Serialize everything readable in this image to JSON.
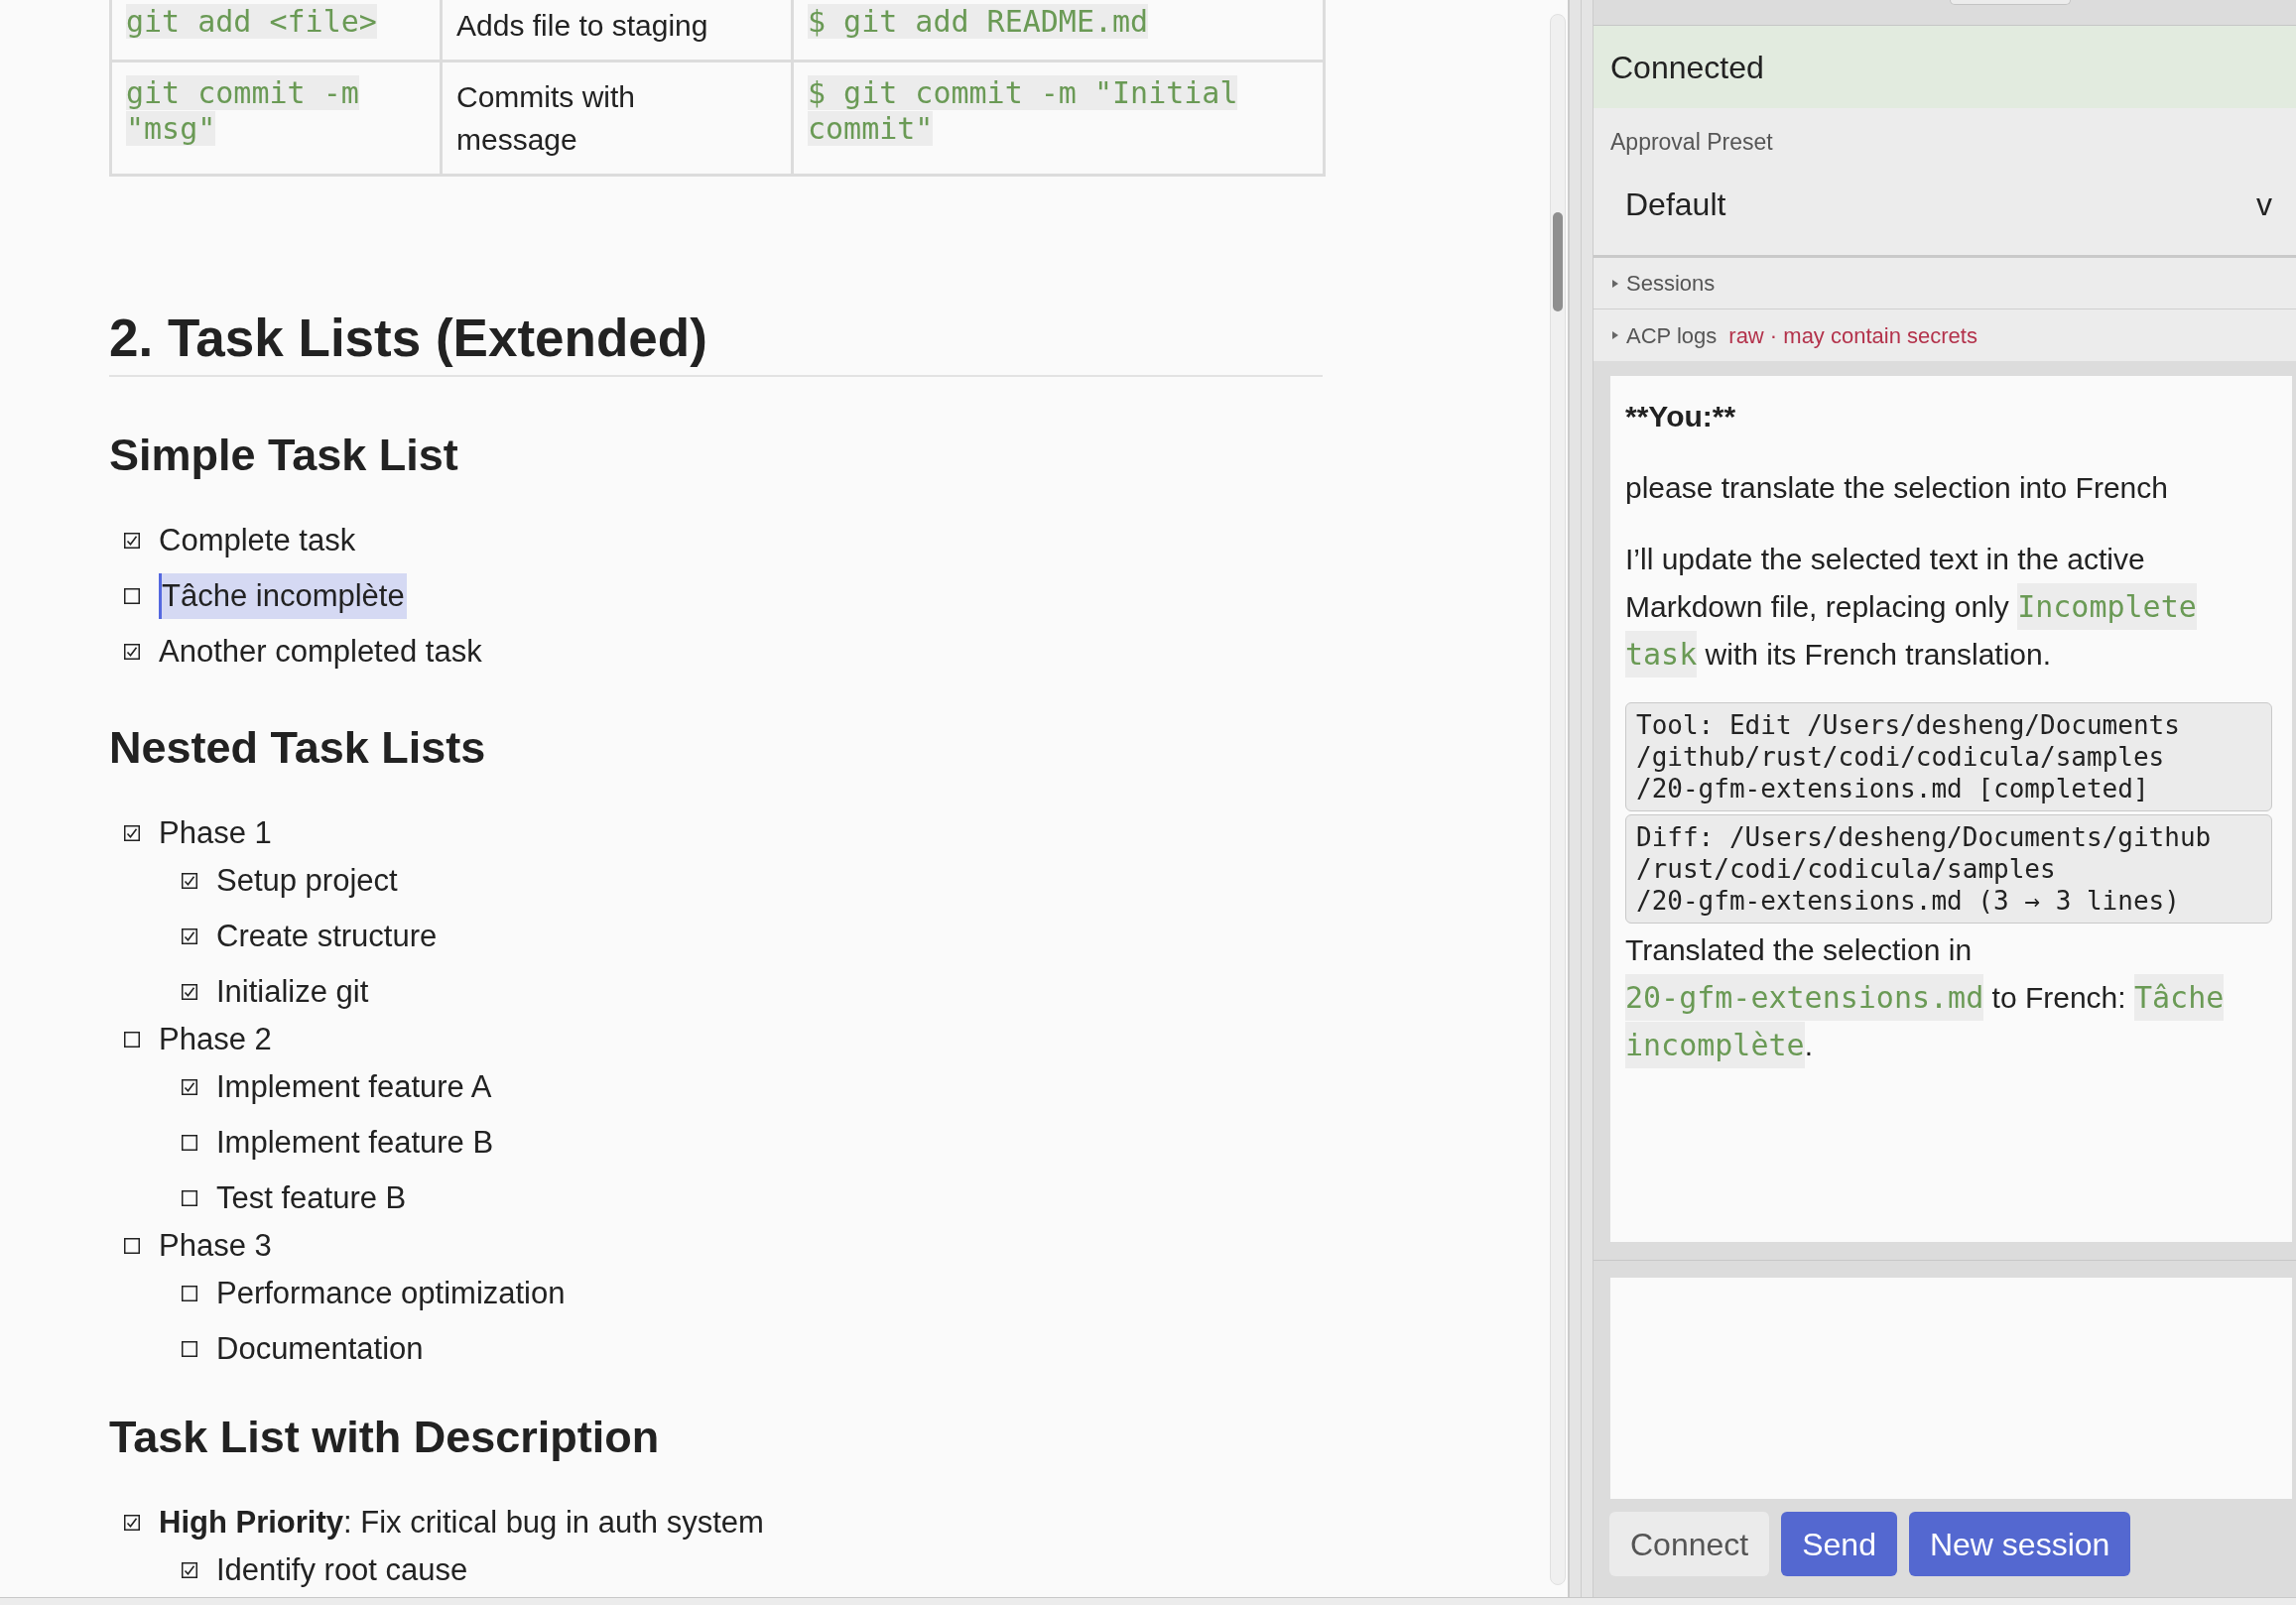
{
  "editor": {
    "table": {
      "rows": [
        [
          {
            "kind": "code",
            "text": "git add <file>"
          },
          {
            "kind": "text",
            "text": "Adds file to staging"
          },
          {
            "kind": "code",
            "text": "$ git add README.md"
          }
        ],
        [
          {
            "kind": "code",
            "text": "git commit -m \"msg\""
          },
          {
            "kind": "text",
            "text": "Commits with message"
          },
          {
            "kind": "code",
            "text": "$ git commit -m \"Initial commit\""
          }
        ]
      ]
    },
    "blocks": [
      {
        "kind": "heading2",
        "text": "2. Task Lists (Extended)"
      },
      {
        "kind": "heading3",
        "text": "Simple Task List"
      },
      {
        "kind": "tasks",
        "items": [
          {
            "text": "Complete task",
            "checked": true,
            "selected": false
          },
          {
            "text": "Tâche incomplète",
            "checked": false,
            "selected": true
          },
          {
            "text": "Another completed task",
            "checked": true,
            "selected": false
          }
        ]
      },
      {
        "kind": "heading3",
        "text": "Nested Task Lists"
      },
      {
        "kind": "tasks",
        "items": [
          {
            "text": "Phase 1",
            "checked": true,
            "selected": false,
            "children": [
              {
                "text": "Setup project",
                "checked": true,
                "selected": false
              },
              {
                "text": "Create structure",
                "checked": true,
                "selected": false
              },
              {
                "text": "Initialize git",
                "checked": true,
                "selected": false
              }
            ]
          },
          {
            "text": "Phase 2",
            "checked": false,
            "selected": false,
            "children": [
              {
                "text": "Implement feature A",
                "checked": true,
                "selected": false
              },
              {
                "text": "Implement feature B",
                "checked": false,
                "selected": false
              },
              {
                "text": "Test feature B",
                "checked": false,
                "selected": false
              }
            ]
          },
          {
            "text": "Phase 3",
            "checked": false,
            "selected": false,
            "children": [
              {
                "text": "Performance optimization",
                "checked": false,
                "selected": false
              },
              {
                "text": "Documentation",
                "checked": false,
                "selected": false
              }
            ]
          }
        ]
      },
      {
        "kind": "heading3",
        "text": "Task List with Description"
      },
      {
        "kind": "tasks",
        "items": [
          {
            "text": "**High Priority**: Fix critical bug in auth system",
            "checked": true,
            "selected": false,
            "children": [
              {
                "text": "Identify root cause",
                "checked": true,
                "selected": false
              }
            ]
          }
        ]
      }
    ]
  },
  "agent_panel": {
    "status": {
      "label": "Connected",
      "connected": true
    },
    "approval_preset": {
      "label": "Approval Preset",
      "value": "Default",
      "arrow": "v"
    },
    "sections": [
      {
        "label": "Sessions",
        "expanded": false
      },
      {
        "label": "ACP logs",
        "note": "raw · may contain secrets",
        "expanded": false
      }
    ],
    "messages": [
      {
        "kind": "author",
        "text": "**You:**"
      },
      {
        "kind": "text",
        "parts": [
          {
            "kind": "text",
            "text": "please translate the selection into French"
          }
        ]
      },
      {
        "kind": "text",
        "parts": [
          {
            "kind": "text",
            "text": "I’ll update the selected text in the active Markdown file, replacing only "
          },
          {
            "kind": "code",
            "text": "Incomplete task"
          },
          {
            "kind": "text",
            "text": " with its French translation."
          }
        ]
      },
      {
        "kind": "tool",
        "text": "Tool: Edit /Users/desheng/Documents/github/rust/codi/codicula/samples/20-gfm-extensions.md [completed]"
      },
      {
        "kind": "tool",
        "text": "Diff: /Users/desheng/Documents/github/rust/codi/codicula/samples/20-gfm-extensions.md (3 → 3 lines)"
      },
      {
        "kind": "text",
        "parts": [
          {
            "kind": "text",
            "text": "Translated the selection in "
          },
          {
            "kind": "code",
            "text": "20-gfm-extensions.md"
          },
          {
            "kind": "text",
            "text": " to French: "
          },
          {
            "kind": "code",
            "text": "Tâche incomplète"
          },
          {
            "kind": "text",
            "text": "."
          }
        ]
      }
    ],
    "buttons": [
      {
        "label": "Connect",
        "kind": "secondary"
      },
      {
        "label": "Send",
        "kind": "primary"
      },
      {
        "label": "New session",
        "kind": "primary"
      }
    ]
  }
}
